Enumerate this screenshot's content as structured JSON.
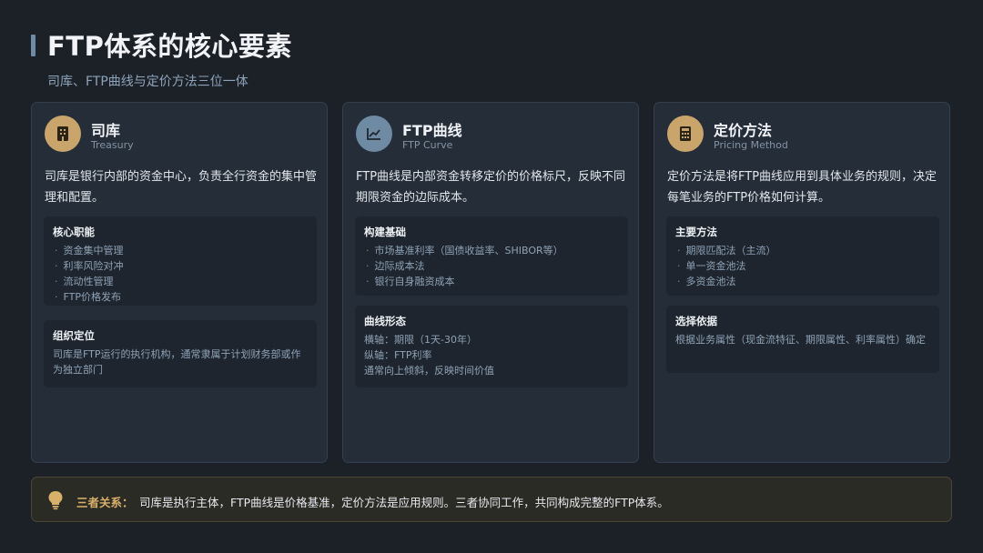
{
  "header": {
    "title": "FTP体系的核心要素",
    "subtitle": "司库、FTP曲线与定价方法三位一体"
  },
  "colors": {
    "accent_gold": "#c9a56c",
    "accent_blue": "#6f8aa3",
    "background": "#1c2128"
  },
  "cards": [
    {
      "icon": "building-icon",
      "title": "司库",
      "subtitle": "Treasury",
      "description": "司库是银行内部的资金中心，负责全行资金的集中管理和配置。",
      "boxes": [
        {
          "title": "核心职能",
          "items": [
            "资金集中管理",
            "利率风险对冲",
            "流动性管理",
            "FTP价格发布"
          ]
        },
        {
          "title": "组织定位",
          "text": "司库是FTP运行的执行机构，通常隶属于计划财务部或作为独立部门"
        }
      ]
    },
    {
      "icon": "line-chart-icon",
      "title": "FTP曲线",
      "subtitle": "FTP Curve",
      "description": "FTP曲线是内部资金转移定价的价格标尺，反映不同期限资金的边际成本。",
      "boxes": [
        {
          "title": "构建基础",
          "items": [
            "市场基准利率（国债收益率、SHIBOR等）",
            "边际成本法",
            "银行自身融资成本"
          ]
        },
        {
          "title": "曲线形态",
          "lines": [
            "横轴：期限（1天-30年）",
            "纵轴：FTP利率",
            "通常向上倾斜，反映时间价值"
          ]
        }
      ]
    },
    {
      "icon": "calculator-icon",
      "title": "定价方法",
      "subtitle": "Pricing Method",
      "description": "定价方法是将FTP曲线应用到具体业务的规则，决定每笔业务的FTP价格如何计算。",
      "boxes": [
        {
          "title": "主要方法",
          "items": [
            "期限匹配法（主流）",
            "单一资金池法",
            "多资金池法"
          ]
        },
        {
          "title": "选择依据",
          "text": "根据业务属性（现金流特征、期限属性、利率属性）确定"
        }
      ]
    }
  ],
  "summary": {
    "icon": "lightbulb-icon",
    "label": "三者关系：",
    "text": "司库是执行主体，FTP曲线是价格基准，定价方法是应用规则。三者协同工作，共同构成完整的FTP体系。"
  }
}
